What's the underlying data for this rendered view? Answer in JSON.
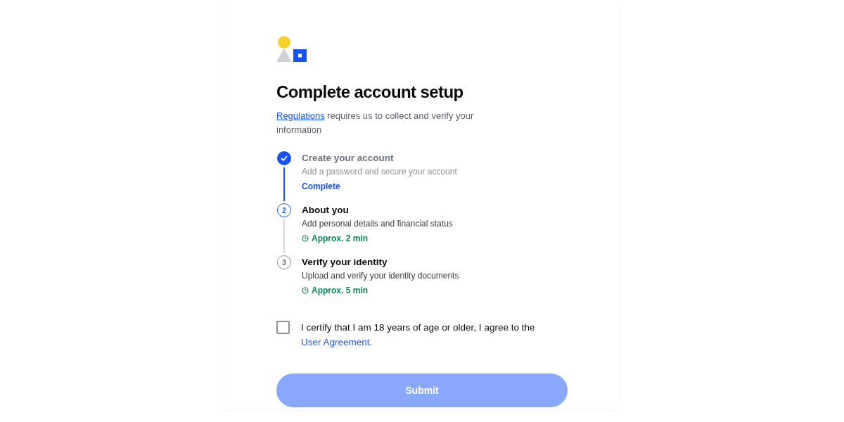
{
  "title": "Complete account setup",
  "intro": {
    "link": "Regulations",
    "text": " requires us to collect and verify your information"
  },
  "steps": [
    {
      "kind": "complete",
      "title": "Create your account",
      "description": "Add a password and secure your account",
      "note": "Complete"
    },
    {
      "number": "2",
      "kind": "current",
      "title": "About you",
      "description": "Add personal details and financial status",
      "note": "Approx. 2 min"
    },
    {
      "number": "3",
      "kind": "pending",
      "title": "Verify your identity",
      "description": "Upload and verify your identity documents",
      "note": "Approx. 5 min"
    }
  ],
  "agreement": {
    "checked": false,
    "text": "I certify that I am 18 years of age or older, I agree to the ",
    "link": "User Agreement",
    "after": "."
  },
  "submit": {
    "label": "Submit",
    "disabled": true
  }
}
